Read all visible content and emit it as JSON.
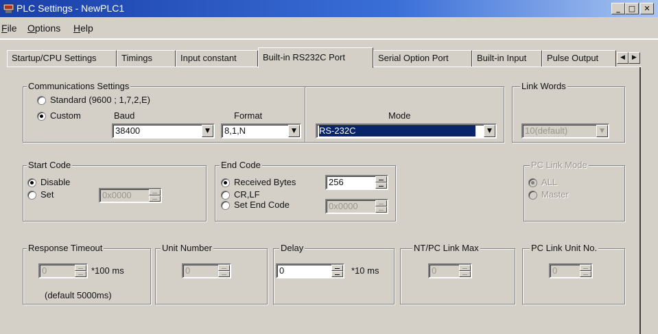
{
  "window": {
    "title": "PLC Settings - NewPLC1",
    "controls": [
      "minimize-icon",
      "maximize-icon",
      "close-icon"
    ],
    "title_gradient": [
      "#1a3fa8",
      "#a8c4f0"
    ]
  },
  "menu": {
    "file": "File",
    "options": "Options",
    "help": "Help"
  },
  "tabs": [
    {
      "label": "Startup/CPU Settings"
    },
    {
      "label": "Timings"
    },
    {
      "label": "Input constant"
    },
    {
      "label": "Built-in RS232C Port",
      "active": true
    },
    {
      "label": "Serial Option Port"
    },
    {
      "label": "Built-in Input"
    },
    {
      "label": "Pulse Output"
    }
  ],
  "tab_scroll": {
    "left": "◀",
    "right": "▶"
  },
  "comm": {
    "legend": "Communications Settings",
    "standard_label": "Standard (9600 ; 1,7,2,E)",
    "custom_label": "Custom",
    "custom_selected": true,
    "baud_label": "Baud",
    "baud_value": "38400",
    "format_label": "Format",
    "format_value": "8,1,N",
    "mode_label": "Mode",
    "mode_value": "RS-232C"
  },
  "link_words": {
    "legend": "Link Words",
    "value": "10(default)"
  },
  "start_code": {
    "legend": "Start Code",
    "disable_label": "Disable",
    "set_label": "Set",
    "selected": "Disable",
    "value": "0x0000"
  },
  "end_code": {
    "legend": "End Code",
    "received_label": "Received Bytes",
    "received_value": "256",
    "crlf_label": "CR,LF",
    "set_label": "Set End Code",
    "set_value": "0x0000",
    "selected": "Received Bytes"
  },
  "pc_link_mode": {
    "legend": "PC Link Mode",
    "all_label": "ALL",
    "master_label": "Master",
    "selected": "ALL"
  },
  "response_timeout": {
    "legend": "Response Timeout",
    "value": "0",
    "unit": "*100 ms",
    "note": "(default 5000ms)"
  },
  "unit_number": {
    "legend": "Unit Number",
    "value": "0"
  },
  "delay": {
    "legend": "Delay",
    "value": "0",
    "unit": "*10 ms"
  },
  "ntpc_link_max": {
    "legend": "NT/PC Link Max",
    "value": "0"
  },
  "pc_link_unit_no": {
    "legend": "PC Link Unit No.",
    "value": "0"
  },
  "colors": {
    "face": "#d4d0c8",
    "selection": "#0a246a",
    "disabled_text": "#9a968e"
  }
}
